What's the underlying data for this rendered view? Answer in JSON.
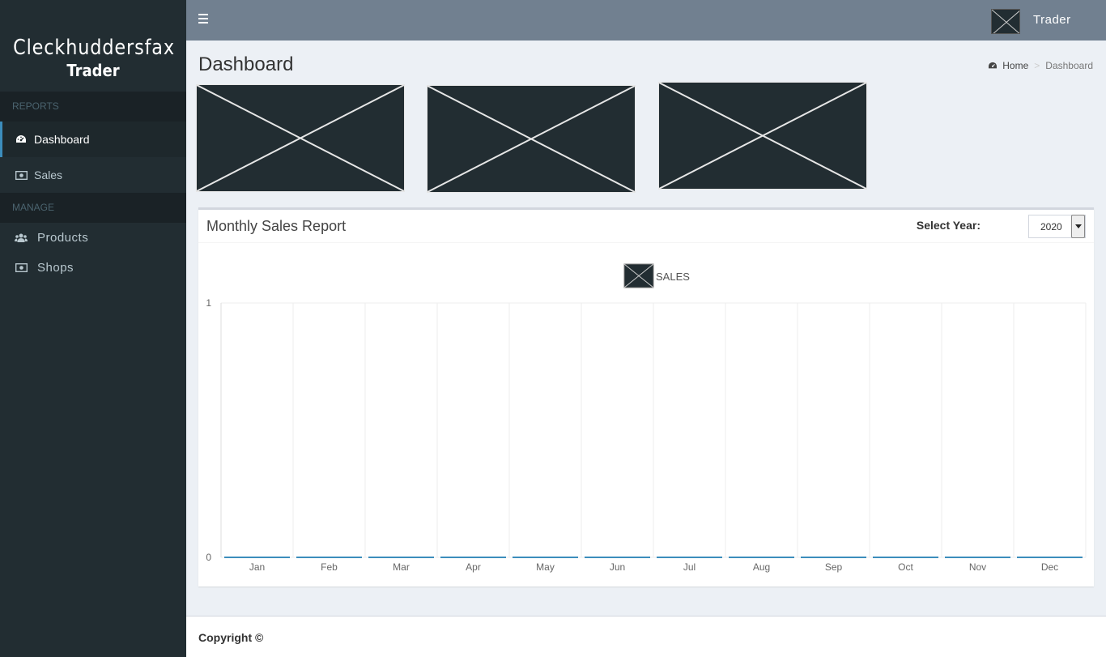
{
  "sidebar": {
    "brand_line1": "Cleckhuddersfax",
    "brand_line2": "Trader",
    "sections": [
      {
        "header": "REPORTS",
        "items": [
          {
            "label": "Dashboard",
            "icon": "dashboard-icon",
            "active": true
          },
          {
            "label": "Sales",
            "icon": "money-icon",
            "active": false
          }
        ]
      },
      {
        "header": "MANAGE",
        "items": [
          {
            "label": "Products",
            "icon": "users-icon",
            "active": false
          },
          {
            "label": "Shops",
            "icon": "money-icon",
            "active": false
          }
        ]
      }
    ]
  },
  "header": {
    "user_name": "Trader"
  },
  "page": {
    "title": "Dashboard",
    "breadcrumb_home": "Home",
    "breadcrumb_sep": ">",
    "breadcrumb_current": "Dashboard"
  },
  "report": {
    "title": "Monthly Sales Report",
    "year_label": "Select Year:",
    "year_value": "2020"
  },
  "chart_data": {
    "type": "bar",
    "categories": [
      "Jan",
      "Feb",
      "Mar",
      "Apr",
      "May",
      "Jun",
      "Jul",
      "Aug",
      "Sep",
      "Oct",
      "Nov",
      "Dec"
    ],
    "series": [
      {
        "name": "SALES",
        "values": [
          0,
          0,
          0,
          0,
          0,
          0,
          0,
          0,
          0,
          0,
          0,
          0
        ]
      }
    ],
    "ylim": [
      0,
      1
    ],
    "yticks": [
      "0",
      "1"
    ],
    "legend": "top-center",
    "grid": true,
    "colors": {
      "series": "#3c8dbc",
      "grid": "#eeeeee",
      "axis": "#dddddd"
    }
  },
  "footer": {
    "copyright": "Copyright ©"
  }
}
